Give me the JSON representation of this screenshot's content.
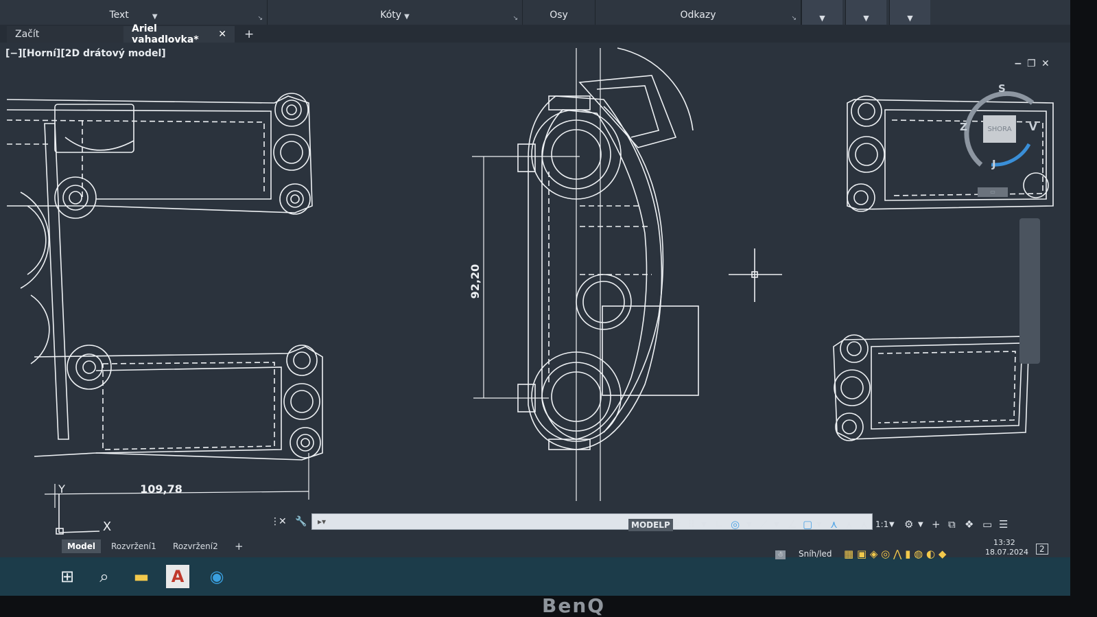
{
  "ribbon": {
    "panels": [
      {
        "label": "Text"
      },
      {
        "label": "Kóty"
      },
      {
        "label": "Osy"
      },
      {
        "label": "Odkazy"
      }
    ]
  },
  "doc_tabs": {
    "start_label": "Začít",
    "active_label": "Ariel vahadlovka*",
    "close_glyph": "✕",
    "add_glyph": "+"
  },
  "viewport": {
    "label": "[−][Horní][2D drátový model]"
  },
  "viewcube": {
    "north": "S",
    "south": "J",
    "west": "Z",
    "east": "V",
    "face": "SHORA"
  },
  "dimensions": {
    "vertical": "92,20",
    "horizontal": "109,78"
  },
  "ucs": {
    "x_label": "X",
    "y_label": "Y"
  },
  "status_bar": {
    "model_space": "MODELP",
    "scale": "1:1"
  },
  "layout_tabs": [
    {
      "label": "Model"
    },
    {
      "label": "Rozvržení1"
    },
    {
      "label": "Rozvržení2"
    }
  ],
  "layout_add": "+",
  "tray": {
    "weather": "Sníh/led",
    "time": "13:32",
    "date": "18.07.2024",
    "notifications": "2"
  },
  "monitor_brand": "BenQ"
}
